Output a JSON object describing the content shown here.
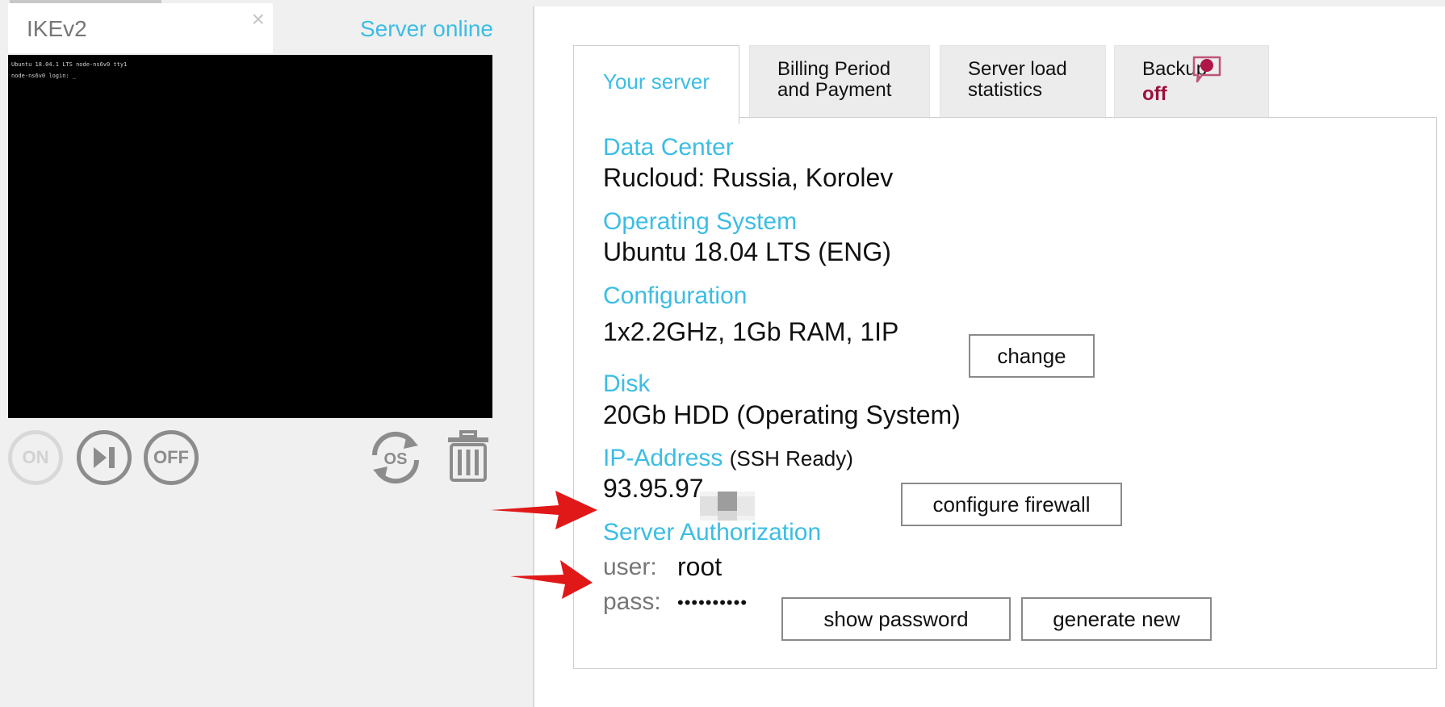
{
  "server_tab": {
    "name": "IKEv2",
    "close_glyph": "×"
  },
  "server_status": "Server online",
  "console_lines": [
    "Ubuntu 18.04.1 LTS node-ns6v0 tty1",
    "node-ns6v0 login: _"
  ],
  "controls": {
    "on_label": "ON",
    "off_label": "OFF",
    "os_label": "OS"
  },
  "tabs": {
    "your_server": "Your server",
    "billing": "Billing Period\nand Payment",
    "load": "Server load\nstatistics",
    "backup": "Backup",
    "backup_status": "off"
  },
  "details": {
    "data_center": {
      "label": "Data Center",
      "value": "Rucloud: Russia, Korolev"
    },
    "os": {
      "label": "Operating System",
      "value": "Ubuntu 18.04 LTS (ENG)"
    },
    "configuration": {
      "label": "Configuration",
      "value": "1x2.2GHz, 1Gb RAM, 1IP",
      "button": "change"
    },
    "disk": {
      "label": "Disk",
      "value": "20Gb HDD (Operating System)"
    },
    "ip": {
      "label": "IP-Address",
      "note": "(SSH Ready)",
      "value": "93.95.97.",
      "button": "configure firewall"
    },
    "auth": {
      "label": "Server Authorization",
      "user_key": "user:",
      "user_value": "root",
      "pass_key": "pass:",
      "pass_value": "••••••••••",
      "show_button": "show password",
      "generate_button": "generate new"
    }
  },
  "colors": {
    "accent": "#3cbde4",
    "backup_off": "#9b0f3c",
    "annotation_arrow": "#e11818"
  },
  "icons": [
    "close-icon",
    "power-on-icon",
    "restart-icon",
    "power-off-icon",
    "reinstall-os-icon",
    "trash-icon",
    "chat-icon",
    "annotation-arrow-icon"
  ]
}
